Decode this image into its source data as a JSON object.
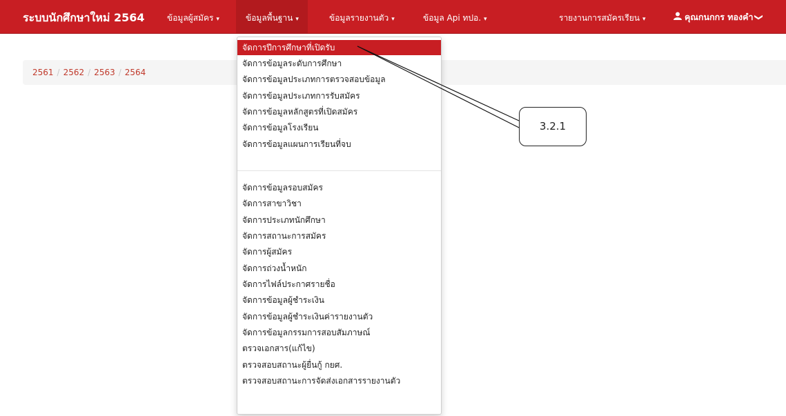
{
  "navbar": {
    "brand": "ระบบนักศึกษาใหม่ 2564",
    "menus": [
      {
        "label": "ข้อมูลผู้สมัคร",
        "caret": "▾"
      },
      {
        "label": "ข้อมูลพื้นฐาน",
        "caret": "▾"
      },
      {
        "label": "ข้อมูลรายงานตัว",
        "caret": "▾"
      },
      {
        "label": "ข้อมูล Api ทปอ.",
        "caret": "▾"
      },
      {
        "label": "รายงานการสมัครเรียน",
        "caret": "▾"
      }
    ],
    "user": {
      "name": "คุณกนกกร ทองคำ",
      "icon": "user-icon",
      "chevron": "❯"
    }
  },
  "breadcrumb": {
    "years": [
      "2561",
      "2562",
      "2563",
      "2564"
    ],
    "separator": "/"
  },
  "dropdown": {
    "group1": [
      "จัดการปีการศึกษาที่เปิดรับ",
      "จัดการข้อมูลระดับการศึกษา",
      "จัดการข้อมูลประเภทการตรวจสอบข้อมูล",
      "จัดการข้อมูลประเภทการรับสมัคร",
      "จัดการข้อมูลหลักสูตรที่เปิดสมัคร",
      "จัดการข้อมูลโรงเรียน",
      "จัดการข้อมูลแผนการเรียนที่จบ"
    ],
    "group2": [
      "จัดการข้อมูลรอบสมัคร",
      "จัดการสาขาวิชา",
      "จัดการประเภทนักศึกษา",
      "จัดการสถานะการสมัคร",
      "จัดการผู้สมัคร",
      "จัดการถ่วงน้ำหนัก",
      "จัดการไฟล์ประกาศรายชื่อ",
      "จัดการข้อมูลผู้ชำระเงิน",
      "จัดการข้อมูลผู้ชำระเงินค่ารายงานตัว",
      "จัดการข้อมูลกรรมการสอบสัมภาษณ์",
      "ตรวจเอกสาร(แก้ไข)",
      "ตรวจสอบสถานะผู้ยื่นกู้ กยศ.",
      "ตรวจสอบสถานะการจัดส่งเอกสารรายงานตัว"
    ]
  },
  "callout": {
    "label": "3.2.1"
  },
  "colors": {
    "navbar": "#c81e23",
    "active_item": "#c81e23",
    "breadcrumb_link": "#c0392b"
  }
}
